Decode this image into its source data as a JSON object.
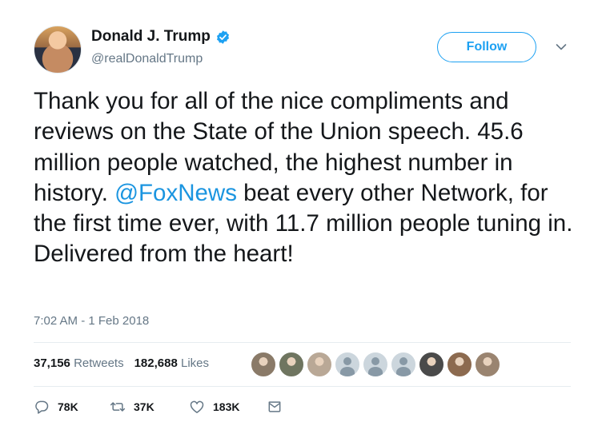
{
  "author": {
    "name": "Donald J. Trump",
    "handle": "@realDonaldTrump",
    "verified": true
  },
  "follow_label": "Follow",
  "tweet": {
    "text_before": "Thank you for all of the nice compliments and reviews on the State of the Union speech. 45.6 million people watched, the highest number in history. ",
    "mention": "@FoxNews",
    "text_after": " beat every other Network, for the first time ever, with 11.7 million people tuning in. Delivered from the heart!"
  },
  "timestamp": "7:02 AM - 1 Feb 2018",
  "stats": {
    "retweets_count": "37,156",
    "retweets_label": "Retweets",
    "likes_count": "182,688",
    "likes_label": "Likes"
  },
  "likers": [
    {
      "icon": "photo-avatar",
      "color": "#8a7a68"
    },
    {
      "icon": "photo-avatar",
      "color": "#6f7560"
    },
    {
      "icon": "photo-avatar",
      "color": "#b9a896"
    },
    {
      "icon": "default-avatar"
    },
    {
      "icon": "default-avatar"
    },
    {
      "icon": "default-avatar"
    },
    {
      "icon": "photo-avatar",
      "color": "#4a4a4a"
    },
    {
      "icon": "photo-avatar",
      "color": "#8c6a4f"
    },
    {
      "icon": "photo-avatar",
      "color": "#9a8470"
    }
  ],
  "actions": {
    "replies": "78K",
    "retweets": "37K",
    "likes": "183K"
  },
  "colors": {
    "accent": "#1da1f2",
    "mention": "#1b95e0",
    "muted": "#657786",
    "text": "#14171a"
  }
}
